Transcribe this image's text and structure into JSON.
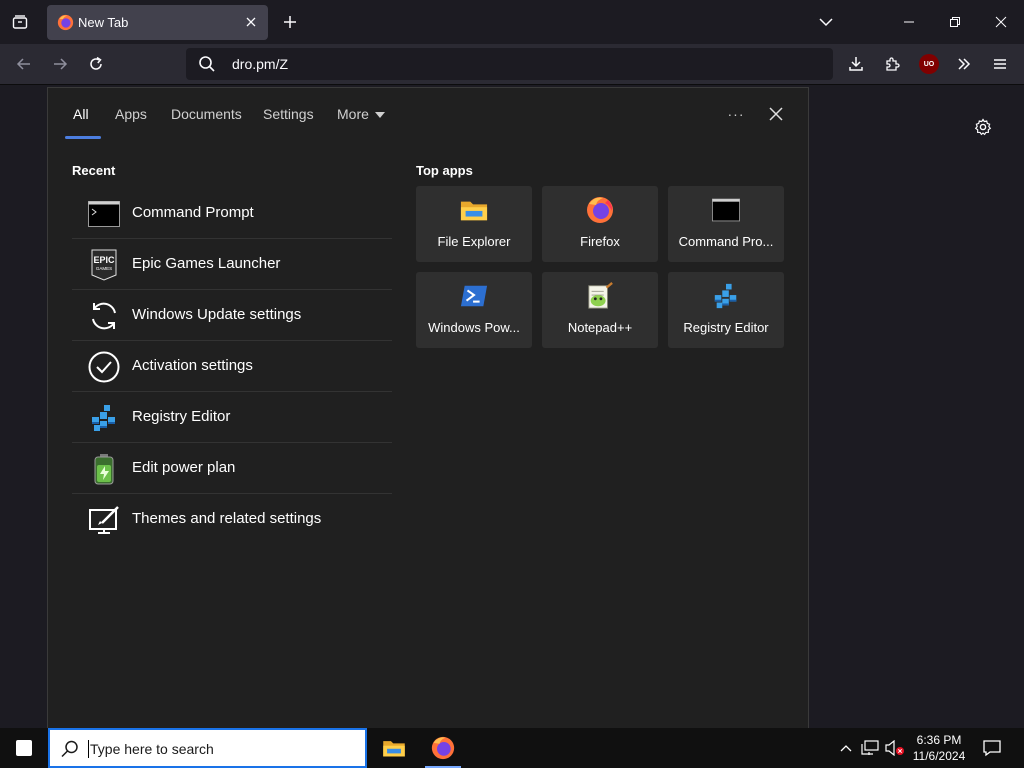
{
  "browser": {
    "tab_title": "New Tab",
    "url": "dro.pm/Z"
  },
  "panel": {
    "tabs": [
      "All",
      "Apps",
      "Documents",
      "Settings",
      "More"
    ],
    "more_menu": "···",
    "recent_title": "Recent",
    "recent": [
      {
        "label": "Command Prompt",
        "icon": "command-prompt-icon"
      },
      {
        "label": "Epic Games Launcher",
        "icon": "epic-games-icon"
      },
      {
        "label": "Windows Update settings",
        "icon": "sync-icon"
      },
      {
        "label": "Activation settings",
        "icon": "check-circle-icon"
      },
      {
        "label": "Registry Editor",
        "icon": "registry-icon"
      },
      {
        "label": "Edit power plan",
        "icon": "battery-icon"
      },
      {
        "label": "Themes and related settings",
        "icon": "paint-brush-icon"
      }
    ],
    "top_apps_title": "Top apps",
    "top_apps": [
      {
        "label": "File Explorer",
        "icon": "folder-icon"
      },
      {
        "label": "Firefox",
        "icon": "firefox-icon"
      },
      {
        "label": "Command Pro...",
        "icon": "command-prompt-icon"
      },
      {
        "label": "Windows Pow...",
        "icon": "powershell-icon"
      },
      {
        "label": "Notepad++",
        "icon": "notepadpp-icon"
      },
      {
        "label": "Registry Editor",
        "icon": "registry-icon"
      }
    ]
  },
  "taskbar": {
    "search_placeholder": "Type here to search",
    "time": "6:36 PM",
    "date": "11/6/2024"
  },
  "extension_badge": "UO",
  "colors": {
    "accent": "#4c7ee0",
    "panel_bg": "#202020",
    "tile_bg": "#2f2f2f",
    "browser_bg": "#1c1b22"
  }
}
